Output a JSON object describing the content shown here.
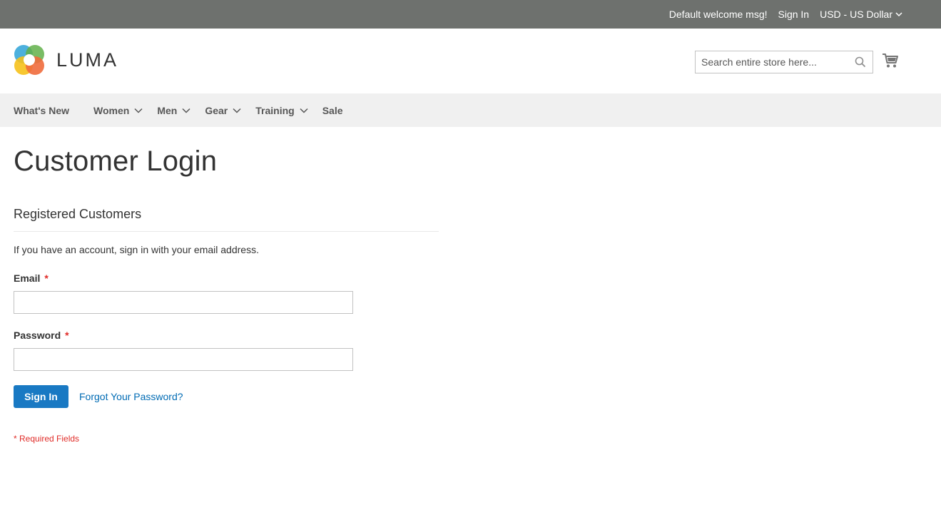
{
  "topbar": {
    "welcome": "Default welcome msg!",
    "sign_in": "Sign In",
    "currency": "USD - US Dollar"
  },
  "header": {
    "logo_text": "LUMA",
    "search_placeholder": "Search entire store here...",
    "cart_icon": "cart-icon",
    "search_icon": "search-icon"
  },
  "nav": {
    "items": [
      {
        "label": "What's New",
        "has_submenu": false
      },
      {
        "label": "Women",
        "has_submenu": true
      },
      {
        "label": "Men",
        "has_submenu": true
      },
      {
        "label": "Gear",
        "has_submenu": true
      },
      {
        "label": "Training",
        "has_submenu": true
      },
      {
        "label": "Sale",
        "has_submenu": false
      }
    ]
  },
  "main": {
    "page_title": "Customer Login",
    "block_title": "Registered Customers",
    "intro": "If you have an account, sign in with your email address.",
    "email_label": "Email",
    "password_label": "Password",
    "required_star": "*",
    "email_value": "",
    "password_value": "",
    "sign_in_button": "Sign In",
    "forgot_password": "Forgot Your Password?",
    "required_fields_note": "* Required Fields"
  },
  "colors": {
    "topbar_bg": "#6e716e",
    "nav_bg": "#f0f0f0",
    "primary_button": "#1979c3",
    "link": "#006bb4",
    "required": "#e02b27"
  }
}
